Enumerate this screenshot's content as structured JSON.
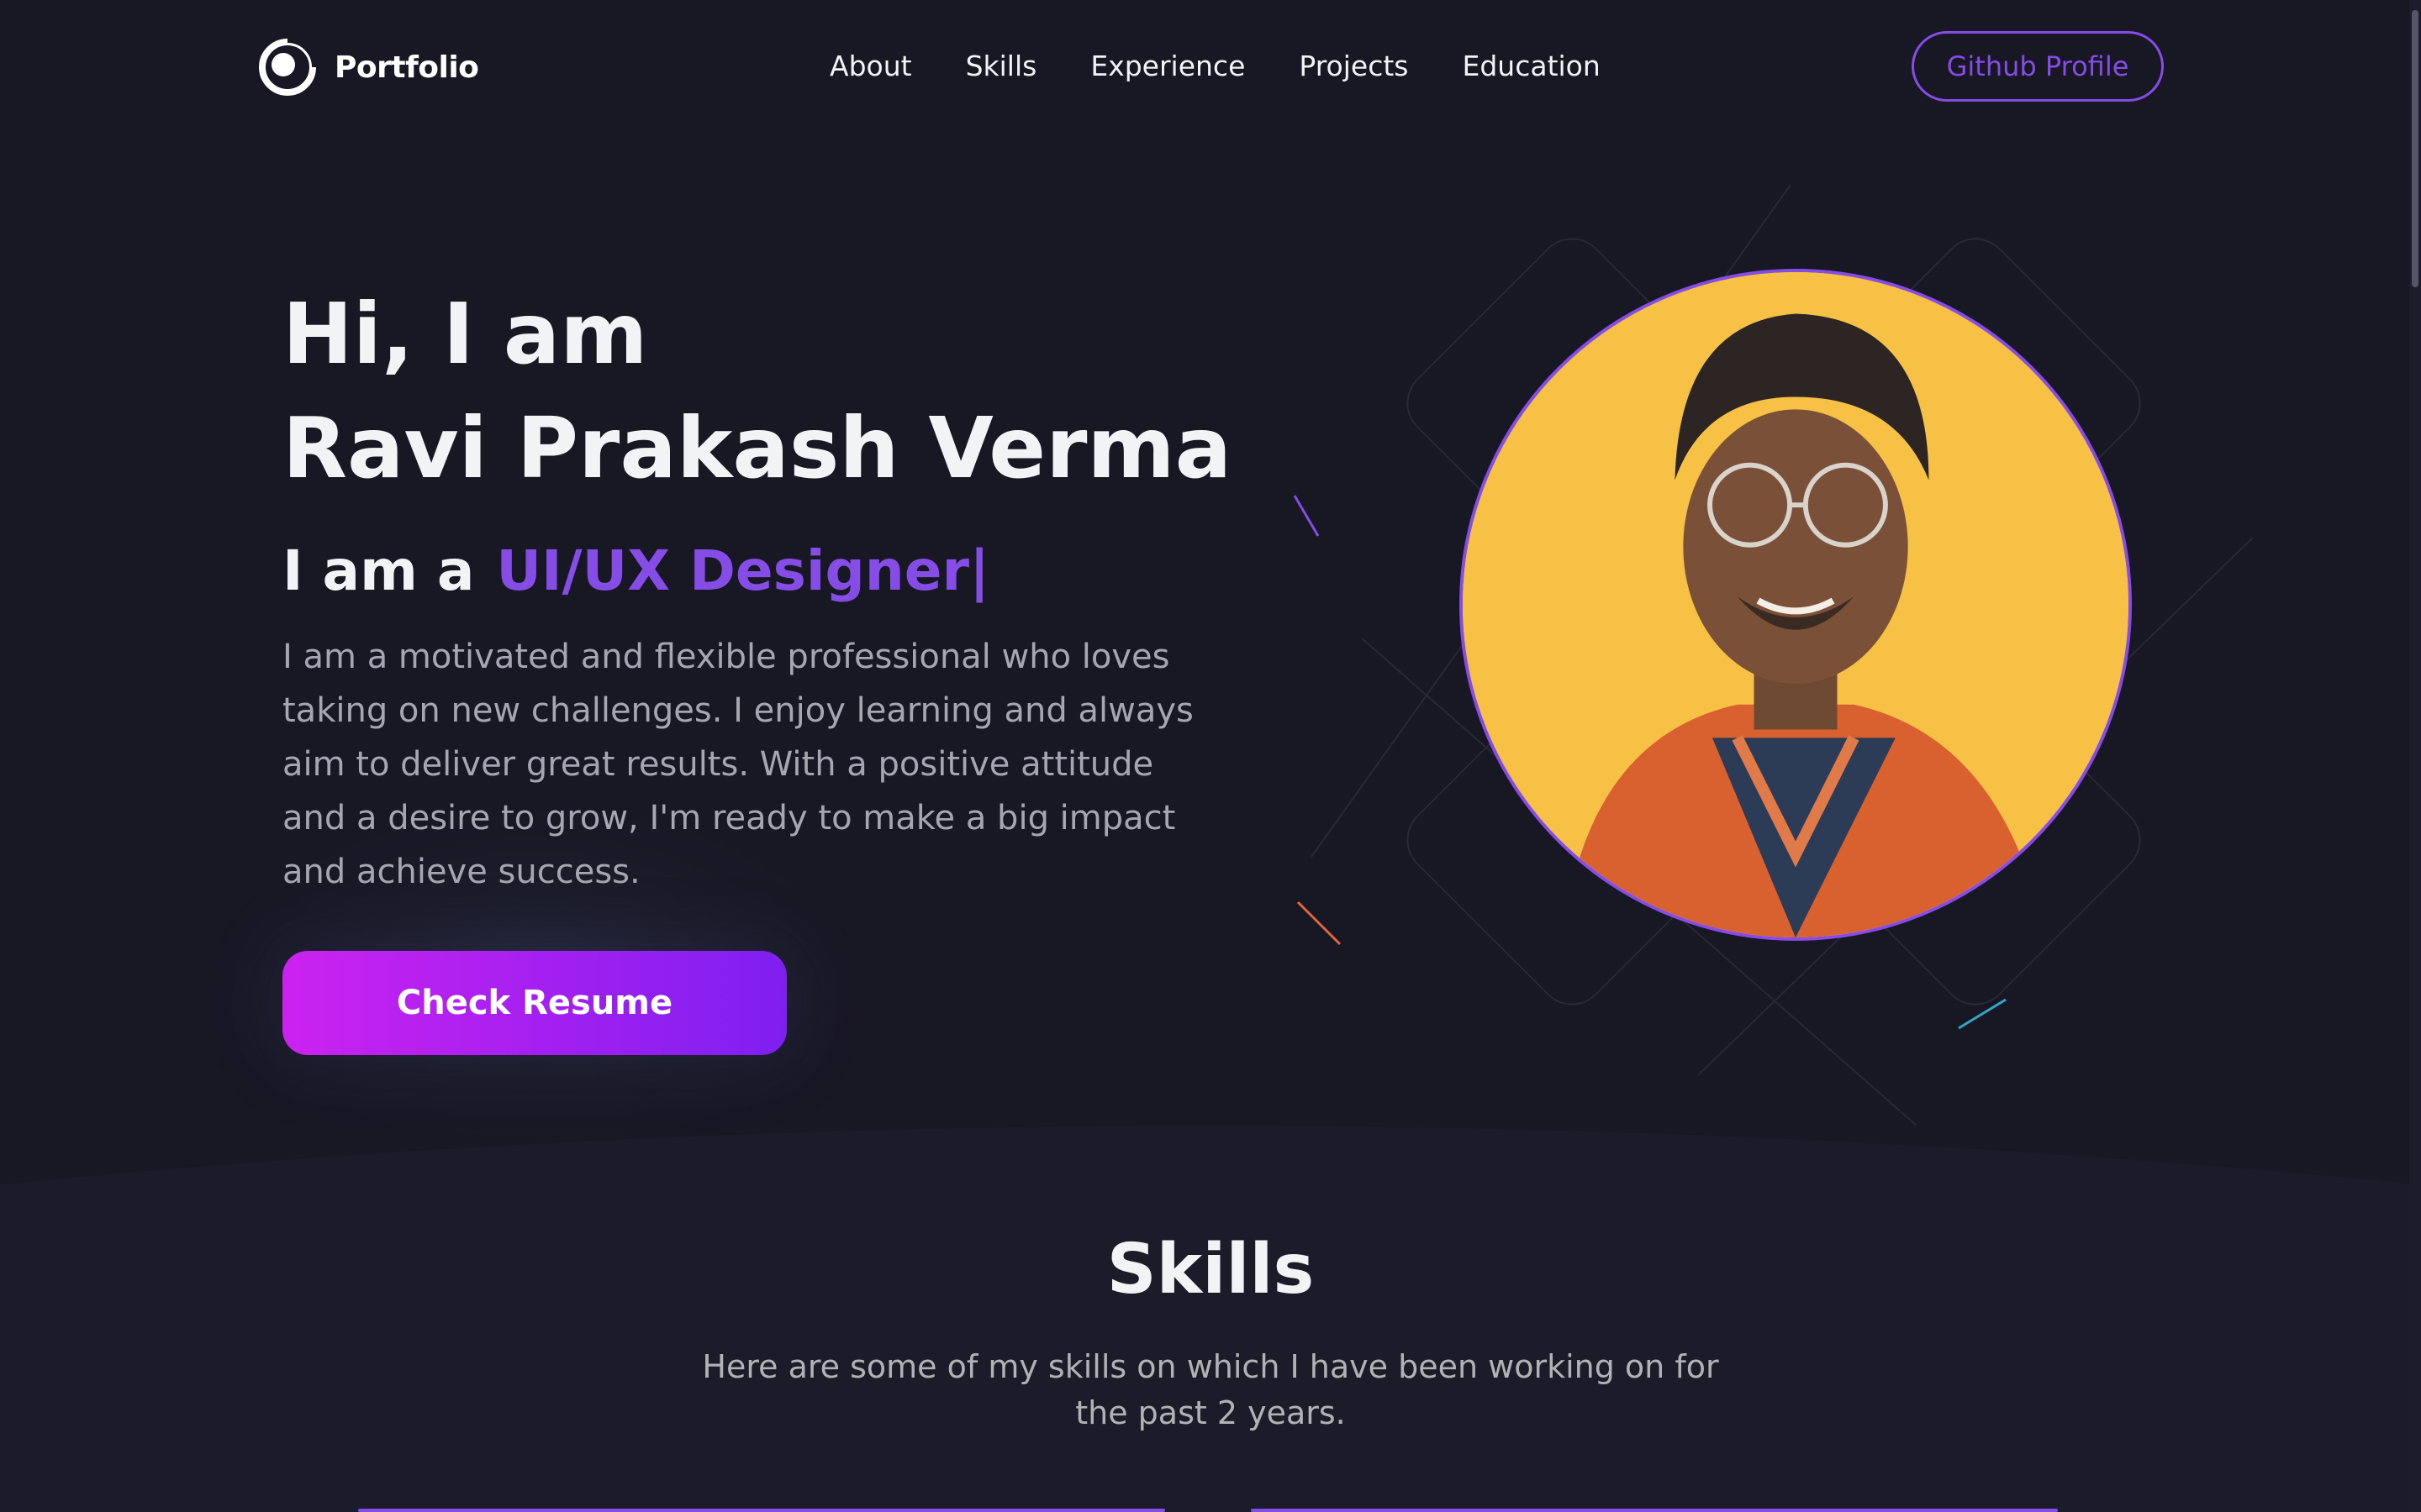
{
  "brand": {
    "name": "Portfolio"
  },
  "nav": {
    "items": [
      {
        "label": "About"
      },
      {
        "label": "Skills"
      },
      {
        "label": "Experience"
      },
      {
        "label": "Projects"
      },
      {
        "label": "Education"
      }
    ],
    "github_button": "Github Profile"
  },
  "hero": {
    "greeting": "Hi, I am",
    "name": "Ravi Prakash Verma",
    "role_prefix": "I am a",
    "role_typed": "UI/UX Designer|",
    "bio": "I am a motivated and flexible professional who loves taking on new challenges. I enjoy learning and always aim to deliver great results. With a positive attitude and a desire to grow, I'm ready to make a big impact and achieve success.",
    "cta": "Check Resume"
  },
  "skills": {
    "title": "Skills",
    "description": "Here are some of my skills on which I have been working on for the past 2 years."
  },
  "colors": {
    "background": "#181724",
    "accent": "#854ce6",
    "cta_gradient_start": "#cc22f0",
    "cta_gradient_end": "#7e1ff0",
    "photo_background": "#f6c145"
  }
}
